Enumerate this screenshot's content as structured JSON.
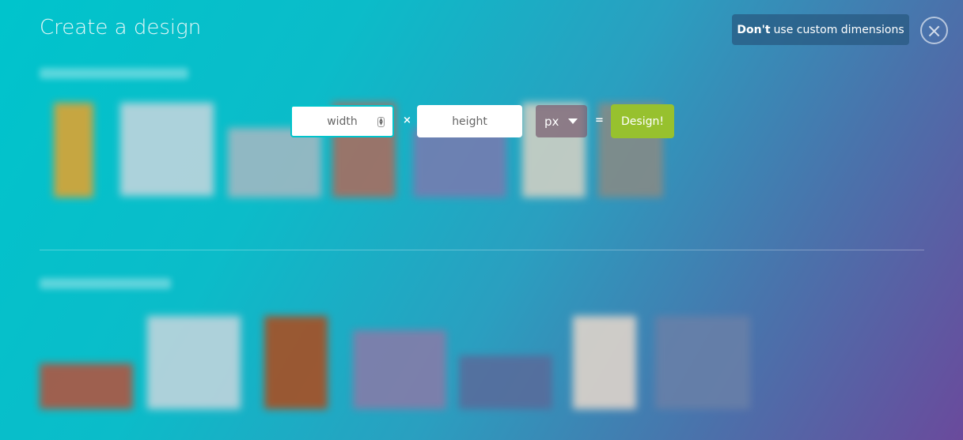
{
  "header": {
    "title": "Create a design"
  },
  "toggle": {
    "bold": "Don't",
    "rest": "use custom dimensions"
  },
  "close": {
    "icon": "close-icon",
    "glyph": "×"
  },
  "custom": {
    "width_placeholder": "width",
    "height_placeholder": "height",
    "times": "×",
    "equals": "=",
    "unit": "px",
    "design_label": "Design!"
  },
  "colors": {
    "accent": "#00c4cc",
    "design_button": "#97c12e"
  }
}
